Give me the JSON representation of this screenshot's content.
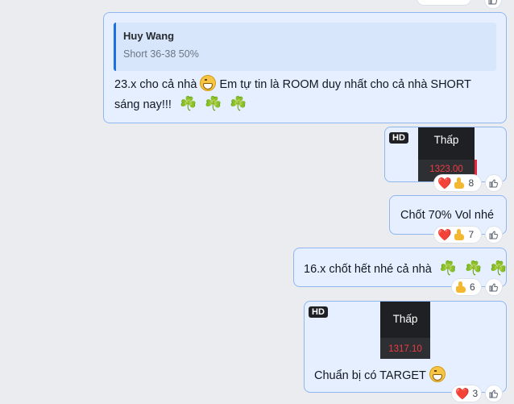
{
  "messages": [
    {
      "quote": {
        "author": "Huy Wang",
        "text": "Short 36-38 50%"
      },
      "line1": "23.x cho cả nhà",
      "line1b": "Em tự tin là ROOM duy nhất cho cả nhà SHORT",
      "line2": "sáng nay!!!",
      "clovers": [
        "☘️",
        "☘️",
        "☘️"
      ]
    },
    {
      "media": {
        "badge": "HD",
        "label": "Thấp",
        "price": "1323.00"
      },
      "reactions": {
        "heart": "❤️",
        "count": "8"
      }
    },
    {
      "text": "Chốt 70% Vol nhé",
      "reactions": {
        "heart": "❤️",
        "count": "7"
      }
    },
    {
      "text": "16.x chốt hết nhé cả nhà",
      "clovers": [
        "☘️",
        "☘️",
        "☘️"
      ],
      "reactions": {
        "count": "6"
      }
    },
    {
      "media": {
        "badge": "HD",
        "label": "Thấp",
        "price": "1317.10"
      },
      "text": "Chuẩn bị có TARGET",
      "reactions": {
        "heart": "❤️",
        "count": "3"
      }
    }
  ],
  "colors": {
    "bubble_bg": "#e5efff",
    "bubble_border": "#90b6ef",
    "quote_accent": "#1d6fe0",
    "price_red": "#ef3c44",
    "heart_red": "#e8273a"
  },
  "icons": {
    "like": "thumbs-up-outline-icon",
    "heart": "heart-icon",
    "thumb": "thumbs-up-emoji-icon",
    "grin": "grinning-face-icon",
    "clover": "shamrock-icon"
  }
}
